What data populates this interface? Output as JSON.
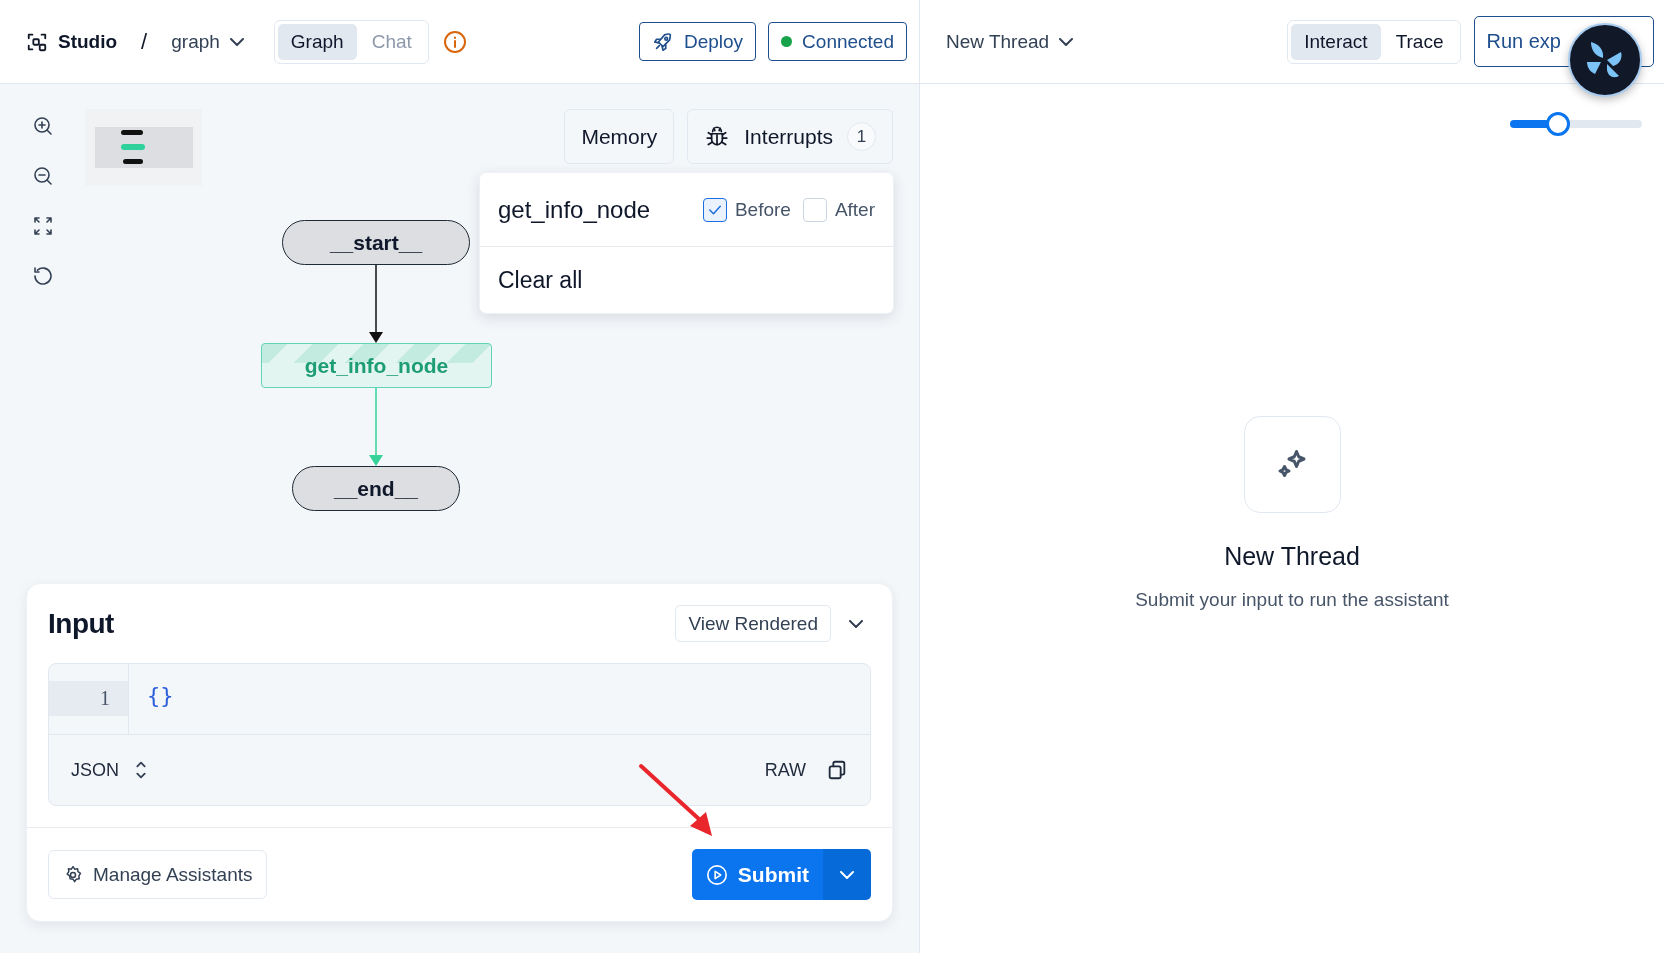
{
  "header": {
    "app_name": "Studio",
    "separator": "/",
    "graph_selector": "graph",
    "view_tabs": [
      {
        "label": "Graph",
        "selected": true,
        "disabled": false
      },
      {
        "label": "Chat",
        "selected": false,
        "disabled": true
      }
    ],
    "deploy_button": "Deploy",
    "connection": {
      "label": "Connected",
      "connected": true
    }
  },
  "canvas": {
    "memory_button": "Memory",
    "interrupts_button": {
      "label": "Interrupts",
      "count": "1"
    },
    "nodes": [
      {
        "label": "__start__",
        "kind": "terminal",
        "highlighted": false
      },
      {
        "label": "get_info_node",
        "kind": "step",
        "highlighted": true
      },
      {
        "label": "__end__",
        "kind": "terminal",
        "highlighted": false
      }
    ],
    "interrupts_menu": {
      "rows": [
        {
          "node": "get_info_node",
          "options": [
            {
              "label": "Before",
              "checked": true
            },
            {
              "label": "After",
              "checked": false
            }
          ]
        }
      ],
      "clear_label": "Clear all"
    }
  },
  "input_panel": {
    "title": "Input",
    "view_button": "View Rendered",
    "editor": {
      "lines": [
        {
          "number": "1",
          "code": "{}"
        }
      ],
      "format": "JSON",
      "mode": "RAW"
    },
    "manage_button": "Manage Assistants",
    "submit_button": "Submit"
  },
  "thread_panel": {
    "thread_selector": "New Thread",
    "tabs": [
      {
        "label": "Interact",
        "selected": true
      },
      {
        "label": "Trace",
        "selected": false
      }
    ],
    "run_button": "Run exp",
    "slider": {
      "level": 0.36
    },
    "empty_state": {
      "title": "New Thread",
      "message": "Submit your input to run the assistant"
    }
  }
}
